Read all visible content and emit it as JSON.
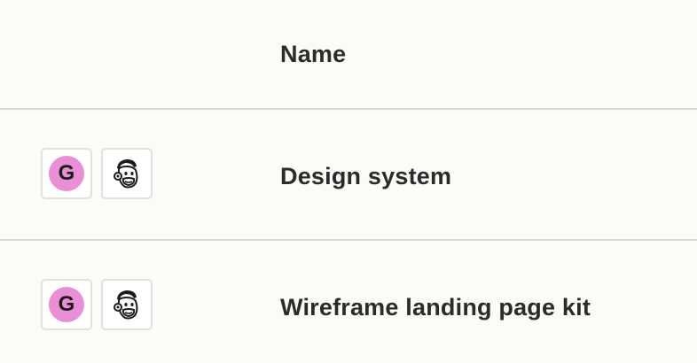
{
  "table": {
    "columns": {
      "icons_header": "",
      "name_header": "Name"
    },
    "rows": [
      {
        "name": "Design system",
        "icons": [
          {
            "icon": "g-letter-icon",
            "letter": "G",
            "color": "#e98fd6"
          },
          {
            "icon": "mailchimp-monkey-icon"
          }
        ]
      },
      {
        "name": "Wireframe landing page kit",
        "icons": [
          {
            "icon": "g-letter-icon",
            "letter": "G",
            "color": "#e98fd6"
          },
          {
            "icon": "mailchimp-monkey-icon"
          }
        ]
      }
    ]
  }
}
